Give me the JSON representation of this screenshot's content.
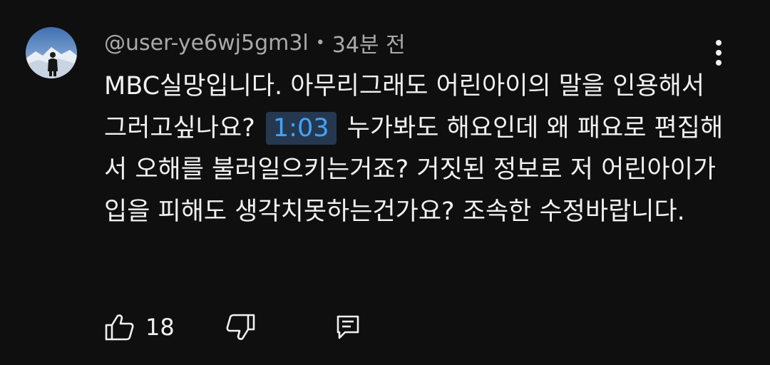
{
  "comment": {
    "handle": "@user-ye6wj5gm3l",
    "separator": "•",
    "time_ago": "34분 전",
    "text_before_timestamp": "MBC실망입니다. 아무리그래도 어린아이의 말을 인용해서 그러고싶나요? ",
    "timestamp_link": "1:03",
    "text_after_timestamp": " 누가봐도 해요인데 왜 패요로 편집해서 오해를 불러일으키는거죠? 거짓된 정보로 저 어린아이가 입을 피해도 생각치못하는건가요? 조속한 수정바랍니다."
  },
  "actions": {
    "like_count": "18"
  },
  "icons": {
    "avatar": "user-avatar-photo",
    "more": "more-vertical-icon",
    "like": "thumbs-up-icon",
    "dislike": "thumbs-down-icon",
    "reply": "reply-comment-icon"
  },
  "colors": {
    "background": "#0f0f0f",
    "text_primary": "#f1f1f1",
    "text_secondary": "#aaaaaa",
    "timestamp_link": "#3ea6ff",
    "timestamp_bg": "#263850"
  }
}
